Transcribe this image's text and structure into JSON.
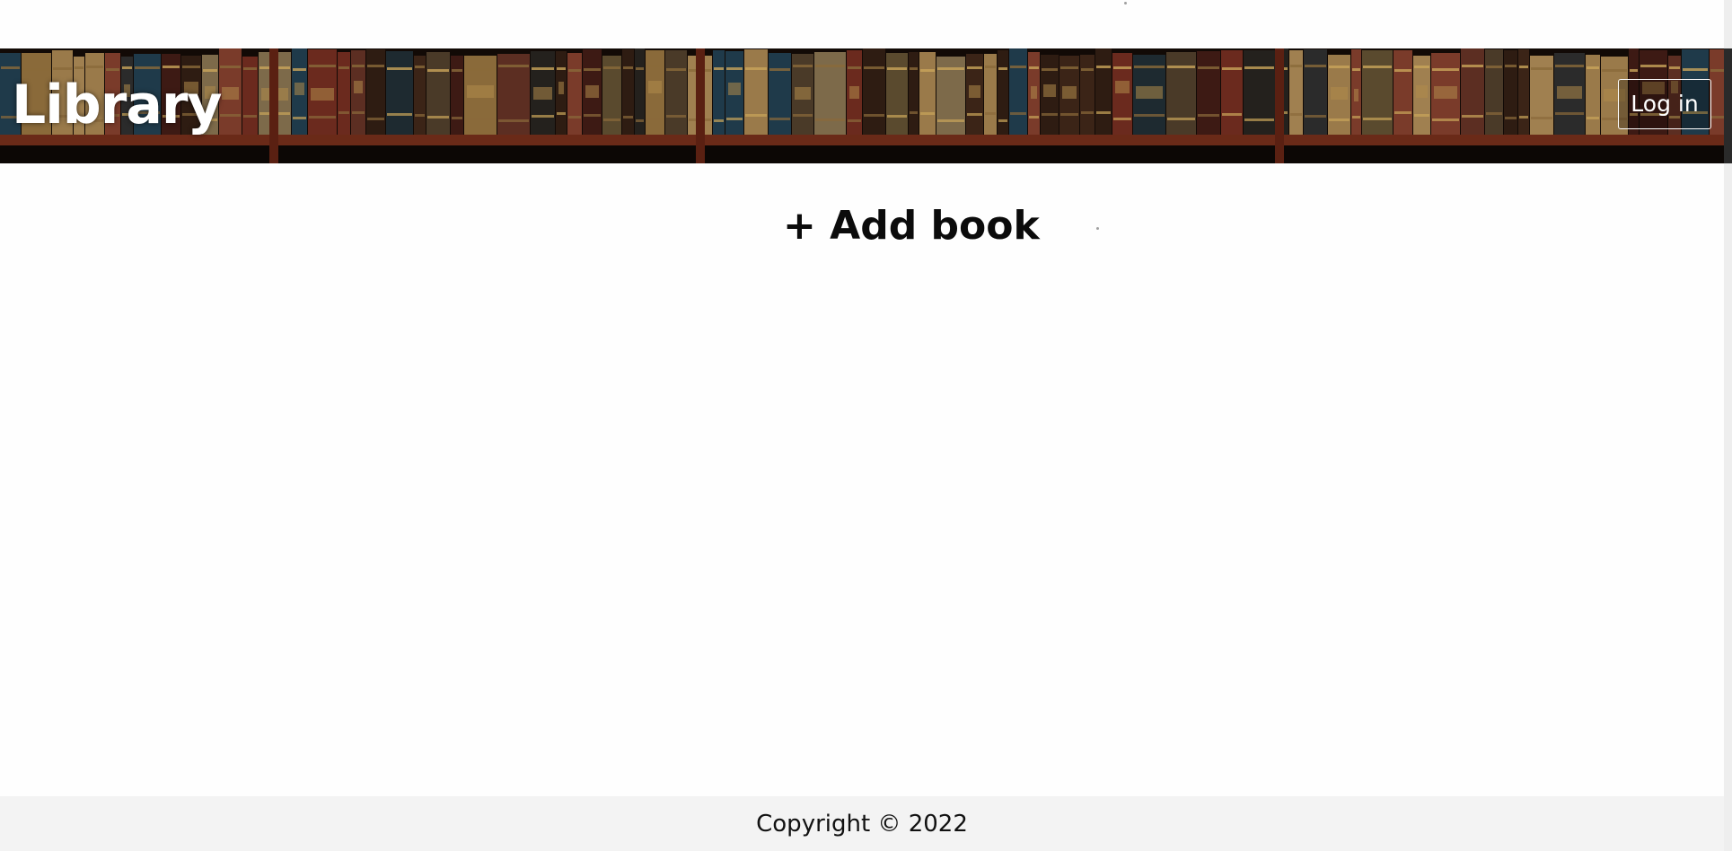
{
  "header": {
    "site_title": "Library",
    "login_label": "Log in",
    "banner_image": "bookshelf-banner"
  },
  "main": {
    "add_book_label": "+ Add book"
  },
  "footer": {
    "copyright": "Copyright © 2022"
  },
  "colors": {
    "page_background": "#fefefe",
    "footer_background": "#f3f3f3",
    "title_text": "#ffffff",
    "body_text": "#0b0b0b"
  }
}
